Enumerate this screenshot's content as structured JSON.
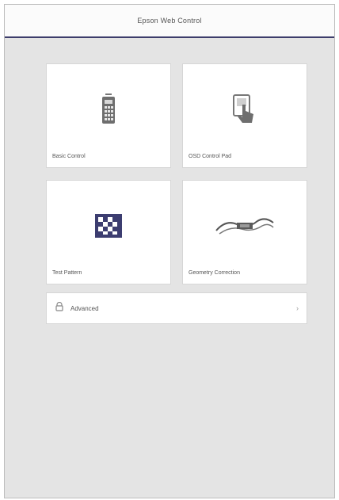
{
  "header": {
    "title": "Epson Web Control"
  },
  "tiles": [
    {
      "label": "Basic Control",
      "icon": "remote-control-icon"
    },
    {
      "label": "OSD Control Pad",
      "icon": "touch-pad-icon"
    },
    {
      "label": "Test Pattern",
      "icon": "test-pattern-icon"
    },
    {
      "label": "Geometry Correction",
      "icon": "geometry-correction-icon"
    }
  ],
  "advanced": {
    "label": "Advanced",
    "icon": "lock-icon",
    "chevron": "›"
  }
}
